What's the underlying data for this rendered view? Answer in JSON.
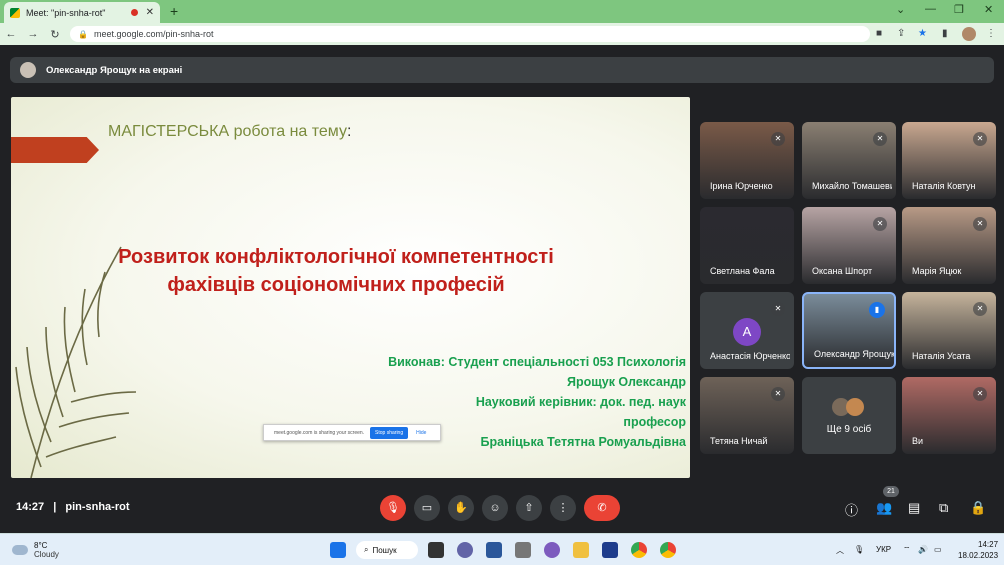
{
  "browser": {
    "tab_title": "Meet: \"pin-snha-rot\"",
    "tab_close": "✕",
    "new_tab": "+",
    "url": "meet.google.com/pin-snha-rot",
    "window_minimize": "⌄",
    "window_min": "—",
    "window_restore": "❐",
    "window_close": "✕"
  },
  "presenter": {
    "name": "Олександр Ярощук на екрані"
  },
  "slide": {
    "topic_prefix": "МАГІСТЕРСЬКА робота на тему",
    "topic_colon": ":",
    "title_line1": "Розвиток конфліктологічної компетентності",
    "title_line2": "фахівців соціономічних професій",
    "authors": [
      "Виконав: Студент спеціальності 053 Психологія",
      "Ярощук Олександр",
      "Науковий керівник: док. пед. наук",
      "професор",
      "Браніцька Тетятна Ромуальдівна"
    ],
    "share_popup": {
      "text": "meet.google.com is sharing your screen.",
      "stop": "Stop sharing",
      "hide": "Hide"
    }
  },
  "participants": [
    {
      "name": "Ірина Юрченко",
      "color": "#7a5a48",
      "muted": true
    },
    {
      "name": "Михайло Томашевич",
      "color": "#8a7f72",
      "muted": true
    },
    {
      "name": "Наталія Ковтун",
      "color": "#c9a890",
      "muted": true
    },
    {
      "name": "Светлана Фала",
      "color": "#2b2a30",
      "muted": false
    },
    {
      "name": "Оксана Шпорт",
      "color": "#b7a4a4",
      "muted": true
    },
    {
      "name": "Марія Яцюк",
      "color": "#b89a86",
      "muted": true
    },
    {
      "name": "Анастасія Юрченко",
      "color": "#3c4043",
      "muted": true,
      "initial": "А"
    },
    {
      "name": "Олександр Ярощук",
      "color": "#7a8c9a",
      "speaking": true
    },
    {
      "name": "Наталія Усата",
      "color": "#c6b49c",
      "muted": true
    },
    {
      "name": "Тетяна Ничай",
      "color": "#6e6258",
      "muted": true
    },
    {
      "name": "Ще 9 осіб",
      "color": "#3c4043",
      "more": true
    },
    {
      "name": "Ви",
      "color": "#b06a64",
      "muted": true
    }
  ],
  "meeting": {
    "time": "14:27",
    "code": "pin-snha-rot",
    "people_count": "21"
  },
  "taskbar": {
    "temp": "8°C",
    "weather": "Cloudy",
    "search": "Пошук",
    "lang": "УКР",
    "clock_time": "14:27",
    "clock_date": "18.02.2023"
  }
}
